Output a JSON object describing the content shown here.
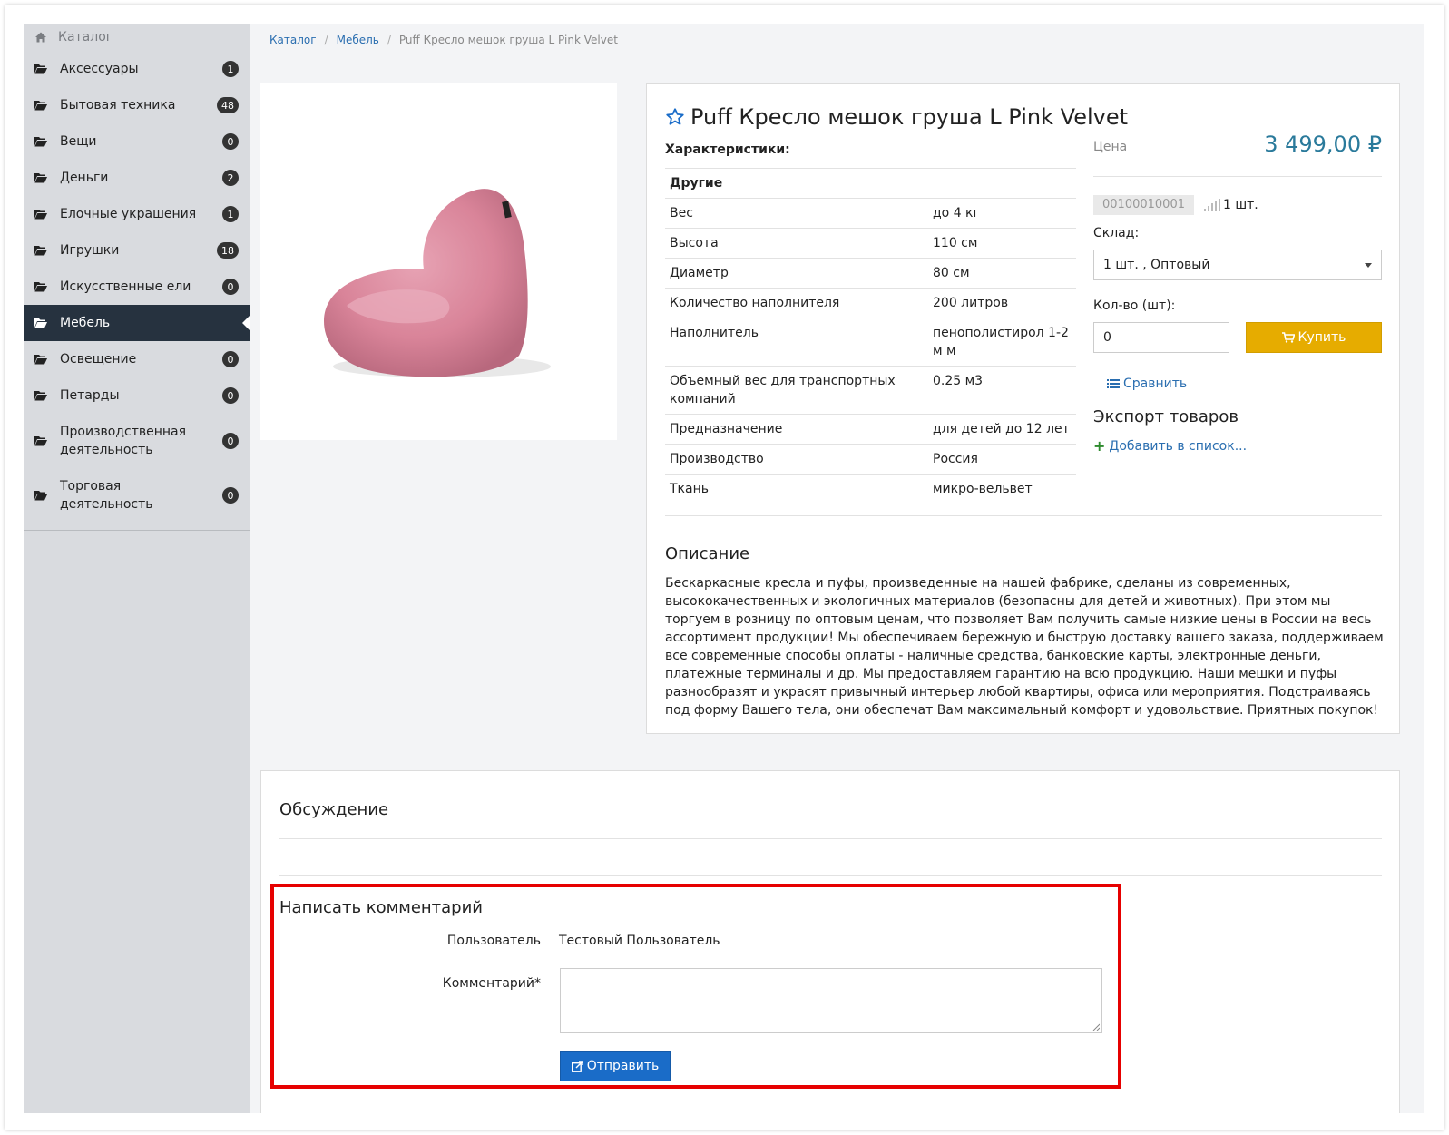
{
  "sidebar": {
    "header": {
      "icon": "home-icon",
      "label": "Каталог"
    },
    "items": [
      {
        "label": "Аксессуары",
        "count": "1"
      },
      {
        "label": "Бытовая техника",
        "count": "48"
      },
      {
        "label": "Вещи",
        "count": "0"
      },
      {
        "label": "Деньги",
        "count": "2"
      },
      {
        "label": "Елочные украшения",
        "count": "1"
      },
      {
        "label": "Игрушки",
        "count": "18"
      },
      {
        "label": "Искусственные ели",
        "count": "0"
      },
      {
        "label": "Мебель",
        "count": "",
        "active": true
      },
      {
        "label": "Освещение",
        "count": "0"
      },
      {
        "label": "Петарды",
        "count": "0"
      },
      {
        "label": "Производственная деятельность",
        "count": "0"
      },
      {
        "label": "Торговая деятельность",
        "count": "0"
      }
    ]
  },
  "breadcrumb": {
    "items": [
      "Каталог",
      "Мебель"
    ],
    "current": "Puff Кресло мешок груша L Pink Velvet"
  },
  "product": {
    "title": "Puff Кресло мешок груша L Pink Velvet",
    "specs_heading": "Характеристики:",
    "spec_group": "Другие",
    "specs": [
      {
        "key": "Вес",
        "value": "до 4 кг"
      },
      {
        "key": "Высота",
        "value": "110 см"
      },
      {
        "key": "Диаметр",
        "value": "80 см"
      },
      {
        "key": "Количество наполнителя",
        "value": "200 литров"
      },
      {
        "key": "Наполнитель",
        "value": "пенополистирол 1-2 м м"
      },
      {
        "key": "Объемный вес для транспортных компаний",
        "value": "0.25 м3"
      },
      {
        "key": "Предназначение",
        "value": "для детей до 12 лет"
      },
      {
        "key": "Производство",
        "value": "Россия"
      },
      {
        "key": "Ткань",
        "value": "микро-вельвет"
      }
    ],
    "price_label": "Цена",
    "price": "3 499,00 ₽",
    "sku": "00100010001",
    "stock": "1 шт.",
    "warehouse_label": "Склад:",
    "warehouse_value": "1 шт. , Оптовый",
    "qty_label": "Кол-во (шт):",
    "qty_value": "0",
    "buy_label": "Купить",
    "compare_label": "Сравнить",
    "export_title": "Экспорт товаров",
    "add_list_label": "Добавить в список...",
    "description_title": "Описание",
    "description": "Бескаркасные кресла и пуфы, произведенные на нашей фабрике, сделаны из современных, высококачественных и экологичных материалов (безопасны для детей и животных). При этом мы торгуем в розницу по оптовым ценам, что позволяет Вам получить самые низкие цены в России на весь ассортимент продукции! Мы обеспечиваем бережную и быструю доставку вашего заказа, поддерживаем все современные способы оплаты - наличные средства, банковские карты, электронные деньги, платежные терминалы и др. Мы предоставляем гарантию на всю продукцию. Наши мешки и пуфы разнообразят и украсят привычный интерьер любой квартиры, офиса или мероприятия. Подстраиваясь под форму Вашего тела, они обеспечат Вам максимальный комфорт и удовольствие. Приятных покупок!"
  },
  "discussion": {
    "title": "Обсуждение",
    "form_title": "Написать комментарий",
    "user_label": "Пользователь",
    "user_value": "Тестовый Пользователь",
    "comment_label": "Комментарий*",
    "comment_value": "",
    "submit_label": "Отправить"
  },
  "colors": {
    "sidebar_bg": "#d9dbdf",
    "sidebar_active": "#26323f",
    "link": "#2a6eb0",
    "price": "#2a7a9b",
    "buy_button": "#e6ac00",
    "submit_button": "#1a6cc8",
    "highlight_box": "#e60000"
  }
}
